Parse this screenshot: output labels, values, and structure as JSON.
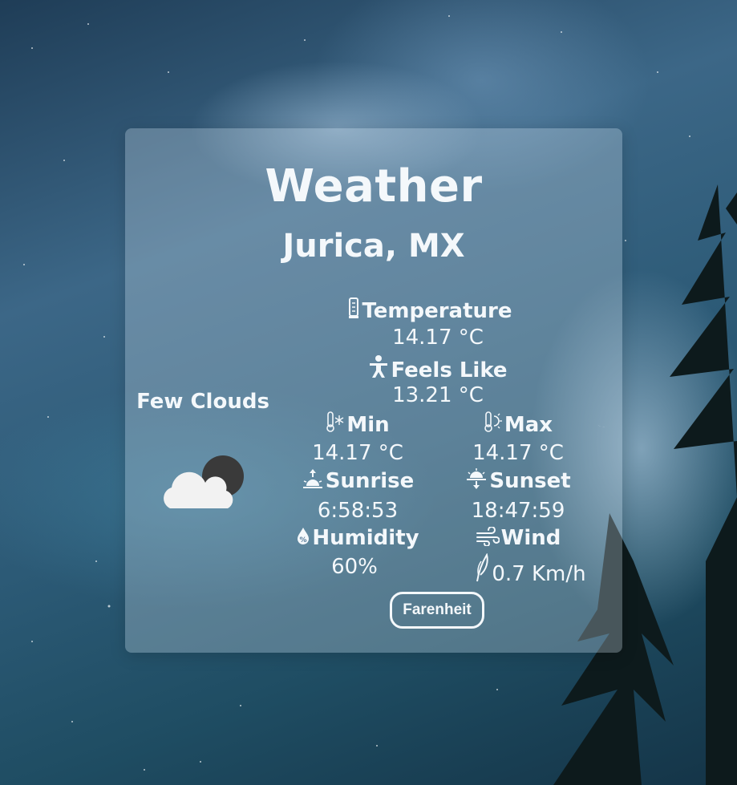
{
  "app": {
    "title": "Weather",
    "city": "Jurica, MX"
  },
  "condition": {
    "text": "Few Clouds",
    "icon": "cloud-moon-icon"
  },
  "metrics": {
    "temperature": {
      "label": "Temperature",
      "value": "14.17 °C",
      "icon": "thermometer-icon"
    },
    "feels_like": {
      "label": "Feels Like",
      "value": "13.21 °C",
      "icon": "person-icon"
    },
    "min": {
      "label": "Min",
      "value": "14.17 °C",
      "icon": "thermometer-cold-icon"
    },
    "max": {
      "label": "Max",
      "value": "14.17 °C",
      "icon": "thermometer-hot-icon"
    },
    "sunrise": {
      "label": "Sunrise",
      "value": "6:58:53",
      "icon": "sunrise-icon"
    },
    "sunset": {
      "label": "Sunset",
      "value": "18:47:59",
      "icon": "sunset-icon"
    },
    "humidity": {
      "label": "Humidity",
      "value": "60%",
      "icon": "humidity-drop-icon"
    },
    "wind": {
      "label": "Wind",
      "value": "0.7 Km/h",
      "icon": "wind-icon",
      "value_icon": "wind-leaf-icon"
    }
  },
  "unit_toggle": {
    "label": "Farenheit"
  },
  "colors": {
    "text": "#f4f8fb",
    "card": "rgba(210,225,240,0.30)",
    "cloud": "#f2f2f2",
    "moon": "#3a3a3a"
  }
}
